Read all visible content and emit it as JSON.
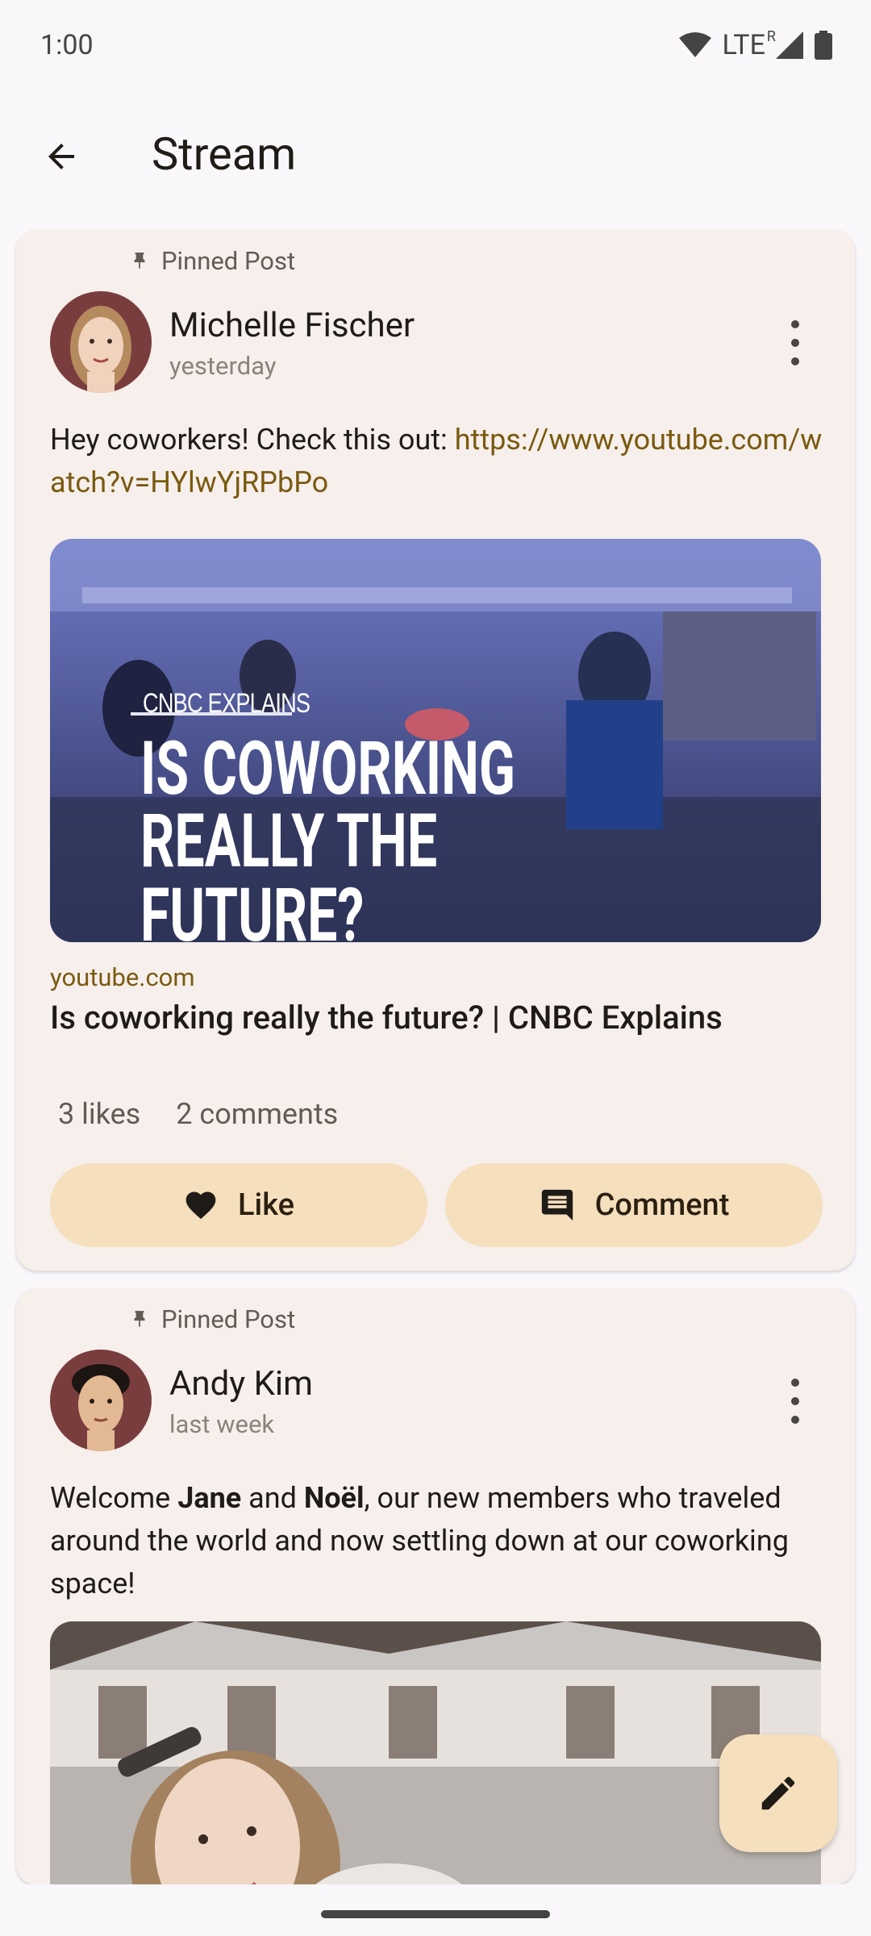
{
  "status_bar": {
    "time": "1:00",
    "network": "LTE",
    "roaming": "R"
  },
  "app_bar": {
    "title": "Stream",
    "back_icon": "arrow-back-icon"
  },
  "posts": [
    {
      "pinned_label": "Pinned Post",
      "author": "Michelle Fischer",
      "time": "yesterday",
      "text": "Hey coworkers! Check this out: ",
      "link": "https://www.youtube.com/watch?v=HYlwYjRPbPo",
      "thumbnail": {
        "kicker": "CNBC EXPLAINS",
        "headline_line1": "IS COWORKING",
        "headline_line2": "REALLY THE FUTURE?"
      },
      "link_preview": {
        "domain": "youtube.com",
        "title": "Is coworking really the future? | CNBC Explains"
      },
      "likes": "3 likes",
      "comments": "2 comments",
      "like_label": "Like",
      "comment_label": "Comment"
    },
    {
      "pinned_label": "Pinned Post",
      "author": "Andy Kim",
      "time": "last week",
      "text_part1": "Welcome ",
      "name1": "Jane",
      "text_part2": " and ",
      "name2": "Noël",
      "text_part3": ", our new members who traveled around the world and now settling down at our coworking space!"
    }
  ],
  "fab": {
    "icon": "edit-pencil-icon"
  },
  "colors": {
    "card": "#f6efec",
    "button": "#f6dfbd",
    "link": "#7a5a0f",
    "background": "#f9f7fa"
  }
}
